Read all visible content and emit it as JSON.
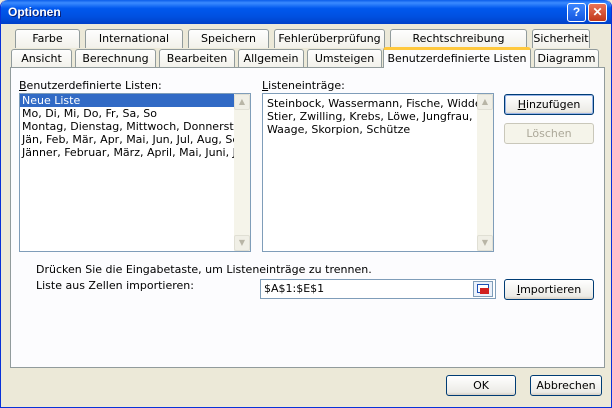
{
  "window": {
    "title": "Optionen",
    "help_glyph": "?",
    "close_glyph": "✕"
  },
  "tabs_row1": [
    "Farbe",
    "International",
    "Speichern",
    "Fehlerüberprüfung",
    "Rechtschreibung",
    "Sicherheit"
  ],
  "tabs_row2": [
    "Ansicht",
    "Berechnung",
    "Bearbeiten",
    "Allgemein",
    "Umsteigen",
    "Benutzerdefinierte Listen",
    "Diagramm"
  ],
  "active_tab": "Benutzerdefinierte Listen",
  "custom_lists": {
    "label_underlined": "B",
    "label_rest": "enutzerdefinierte Listen:",
    "items": [
      "Neue Liste",
      "Mo, Di, Mi, Do, Fr, Sa, So",
      "Montag, Dienstag, Mittwoch, Donnerstag, F",
      "Jän, Feb, Mär, Apr, Mai, Jun, Jul, Aug, Sep,",
      "Jänner, Februar, März, April, Mai, Juni, Juli,"
    ],
    "selected_index": 0
  },
  "list_entries": {
    "label_underlined": "L",
    "label_rest": "isteneinträge:",
    "lines": [
      "Steinbock, Wassermann, Fische, Widder,",
      "Stier, Zwilling, Krebs, Löwe, Jungfrau,",
      "Waage, Skorpion, Schütze"
    ]
  },
  "buttons": {
    "add_underlined": "H",
    "add_rest": "inzufügen",
    "delete": "Löschen",
    "import_underlined": "I",
    "import_rest": "mportieren",
    "ok": "OK",
    "cancel": "Abbrechen"
  },
  "hint_text": "Drücken Sie die Eingabetaste, um Listeneinträge zu trennen.",
  "import_label": "Liste aus Zellen importieren:",
  "import_range": "$A$1:$E$1",
  "colors": {
    "title_blue": "#0050e0",
    "selection": "#316ac5",
    "tab_highlight": "#ffc83c"
  }
}
